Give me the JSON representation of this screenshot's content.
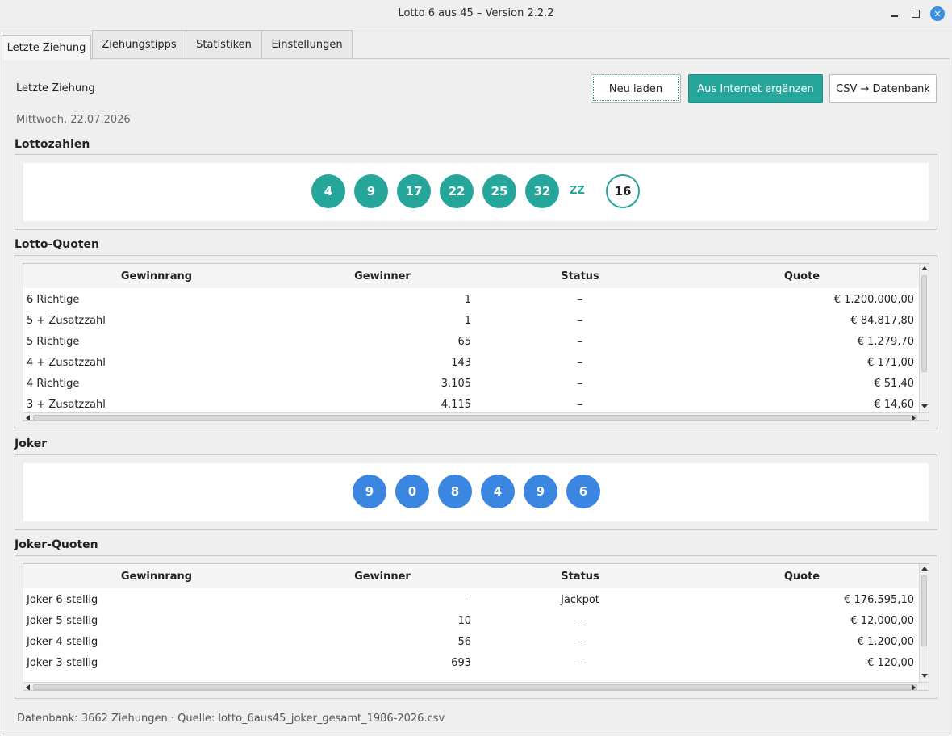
{
  "window": {
    "title": "Lotto 6 aus 45 – Version 2.2.2",
    "close_symbol": "✕"
  },
  "tabs": [
    {
      "label": "Letzte Ziehung",
      "active": true
    },
    {
      "label": "Ziehungstipps",
      "active": false
    },
    {
      "label": "Statistiken",
      "active": false
    },
    {
      "label": "Einstellungen",
      "active": false
    }
  ],
  "header": {
    "title": "Letzte Ziehung",
    "date": "Mittwoch, 22.07.2026"
  },
  "buttons": {
    "reload": "Neu laden",
    "internet": "Aus Internet ergänzen",
    "csv": "CSV → Datenbank"
  },
  "lottozahlen": {
    "heading": "Lottozahlen",
    "numbers": [
      "4",
      "9",
      "17",
      "22",
      "25",
      "32"
    ],
    "zz_label": "ZZ",
    "zusatzzahl": "16"
  },
  "lotto_quoten": {
    "heading": "Lotto-Quoten",
    "columns": [
      "Gewinnrang",
      "Gewinner",
      "Status",
      "Quote"
    ],
    "rows": [
      [
        "6 Richtige",
        "1",
        "–",
        "€ 1.200.000,00"
      ],
      [
        "5 + Zusatzzahl",
        "1",
        "–",
        "€ 84.817,80"
      ],
      [
        "5 Richtige",
        "65",
        "–",
        "€ 1.279,70"
      ],
      [
        "4 + Zusatzzahl",
        "143",
        "–",
        "€ 171,00"
      ],
      [
        "4 Richtige",
        "3.105",
        "–",
        "€ 51,40"
      ],
      [
        "3 + Zusatzzahl",
        "4.115",
        "–",
        "€ 14,60"
      ]
    ]
  },
  "joker": {
    "heading": "Joker",
    "numbers": [
      "9",
      "0",
      "8",
      "4",
      "9",
      "6"
    ]
  },
  "joker_quoten": {
    "heading": "Joker-Quoten",
    "columns": [
      "Gewinnrang",
      "Gewinner",
      "Status",
      "Quote"
    ],
    "rows": [
      [
        "Joker 6-stellig",
        "–",
        "Jackpot",
        "€ 176.595,10"
      ],
      [
        "Joker 5-stellig",
        "10",
        "–",
        "€ 12.000,00"
      ],
      [
        "Joker 4-stellig",
        "56",
        "–",
        "€ 1.200,00"
      ],
      [
        "Joker 3-stellig",
        "693",
        "–",
        "€ 120,00"
      ]
    ]
  },
  "footer": {
    "text": "Datenbank: 3662 Ziehungen · Quelle: lotto_6aus45_joker_gesamt_1986-2026.csv"
  },
  "colors": {
    "accent_teal": "#26a69a",
    "joker_blue": "#3b86e0"
  }
}
